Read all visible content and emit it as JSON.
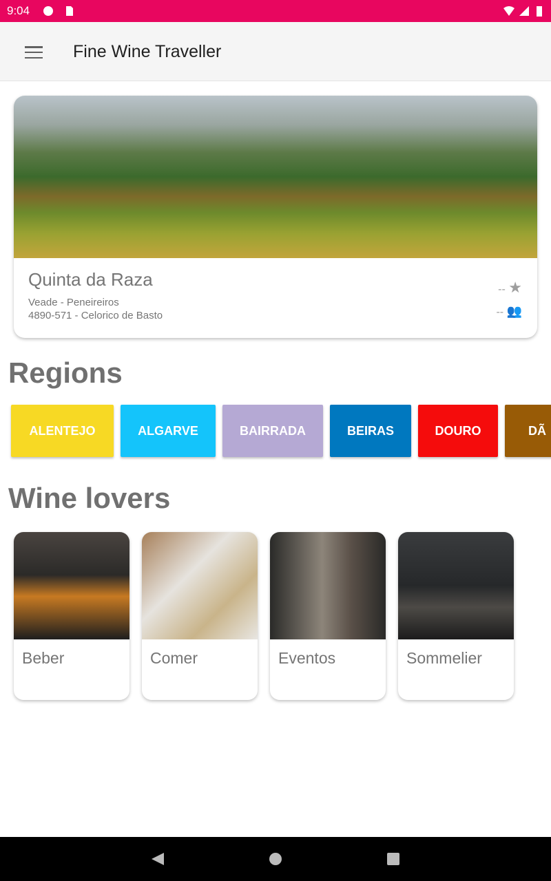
{
  "status_bar": {
    "time": "9:04",
    "color": "#e8065f"
  },
  "app_bar": {
    "title": "Fine Wine Traveller",
    "menu_icon": "hamburger-icon"
  },
  "featured": {
    "name": "Quinta da Raza",
    "address_line1": "Veade - Peneireiros",
    "address_line2": "4890-571 - Celorico de Basto",
    "rating": "--",
    "visitors": "--"
  },
  "regions": {
    "heading": "Regions",
    "items": [
      {
        "label": "ALENTEJO",
        "color": "#f7d924"
      },
      {
        "label": "ALGARVE",
        "color": "#14c4fb"
      },
      {
        "label": "BAIRRADA",
        "color": "#b5a9d4"
      },
      {
        "label": "BEIRAS",
        "color": "#0078bf"
      },
      {
        "label": "DOURO",
        "color": "#f50c0c"
      },
      {
        "label": "DÃ",
        "color": "#985b06"
      }
    ]
  },
  "wine_lovers": {
    "heading": "Wine lovers",
    "items": [
      {
        "label": "Beber"
      },
      {
        "label": "Comer"
      },
      {
        "label": "Eventos"
      },
      {
        "label": "Sommelier"
      }
    ]
  }
}
